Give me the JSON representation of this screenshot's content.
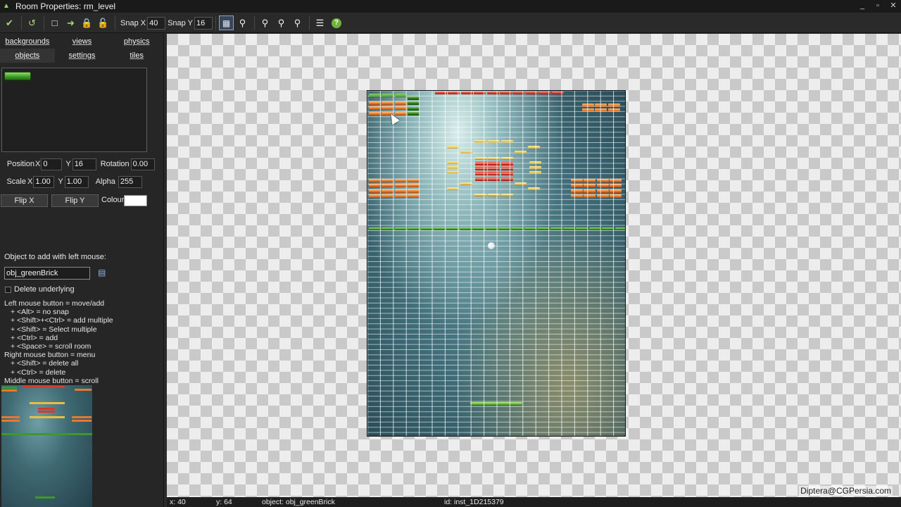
{
  "window": {
    "title": "Room Properties: rm_level",
    "controls": [
      "_",
      "▫",
      "✕"
    ]
  },
  "toolbar": {
    "snap_x_label": "Snap X",
    "snap_x_value": "40",
    "snap_y_label": "Snap Y",
    "snap_y_value": "16"
  },
  "tabs": {
    "row1": [
      "backgrounds",
      "views",
      "physics"
    ],
    "row2": [
      "objects",
      "settings",
      "tiles"
    ],
    "active": "objects"
  },
  "properties": {
    "position_label": "Position",
    "x_label": "X",
    "x_value": "0",
    "y_label": "Y",
    "y_value": "16",
    "rotation_label": "Rotation",
    "rotation_value": "0.00",
    "scale_label": "Scale",
    "scale_x_value": "1.00",
    "scale_y_value": "1.00",
    "alpha_label": "Alpha",
    "alpha_value": "255",
    "flip_x": "Flip X",
    "flip_y": "Flip Y",
    "colour_label": "Colour",
    "colour_value": "#ffffff"
  },
  "object_add": {
    "label": "Object to add with left mouse:",
    "value": "obj_greenBrick",
    "delete_underlying": "Delete underlying"
  },
  "help_lines": [
    {
      "text": "Left mouse button = move/add",
      "indent": false
    },
    {
      "text": "+ <Alt> = no snap",
      "indent": true
    },
    {
      "text": "+ <Shift>+<Ctrl> = add multiple",
      "indent": true
    },
    {
      "text": "+ <Shift> = Select multiple",
      "indent": true
    },
    {
      "text": "+ <Ctrl> = add",
      "indent": true
    },
    {
      "text": "+ <Space> = scroll room",
      "indent": true
    },
    {
      "text": "Right mouse button = menu",
      "indent": false
    },
    {
      "text": "+ <Shift> = delete all",
      "indent": true
    },
    {
      "text": "+ <Ctrl> = delete",
      "indent": true
    },
    {
      "text": "Middle mouse button = scroll",
      "indent": false
    }
  ],
  "status": {
    "x": "x: 40",
    "y": "y: 64",
    "object": "object: obj_greenBrick",
    "id": "id: inst_1D215379"
  },
  "watermark": "Diptera@CGPersia.com",
  "brick_colors": {
    "red": "#d83a2a",
    "orange": "#e8782a",
    "green": "#3c9a28",
    "yellow": "#e8c040"
  }
}
